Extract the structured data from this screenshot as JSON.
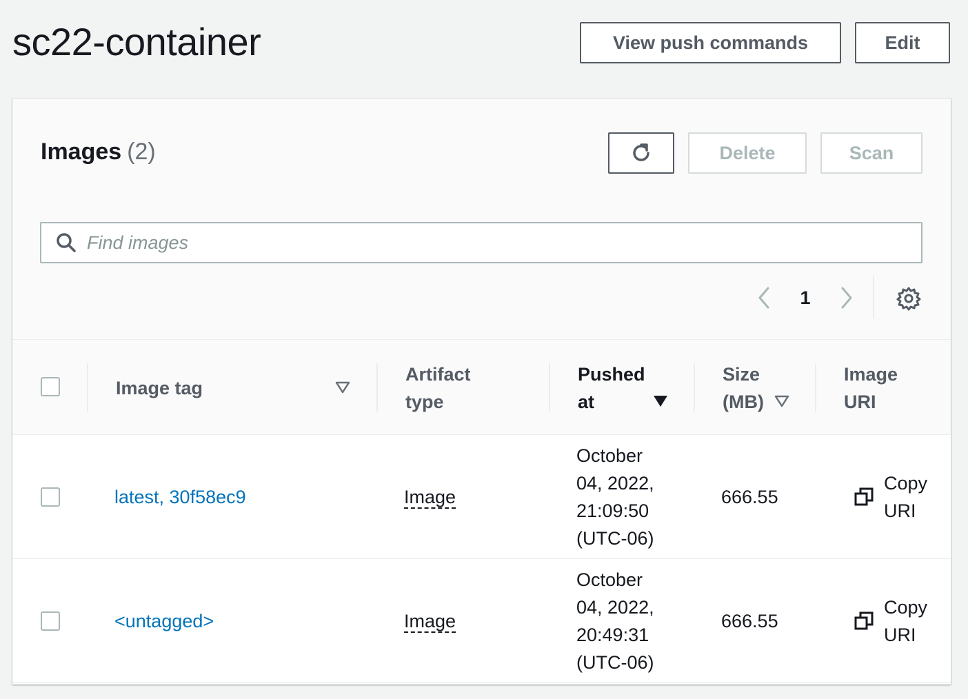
{
  "page": {
    "title": "sc22-container"
  },
  "header_actions": {
    "push_label": "View push commands",
    "edit_label": "Edit"
  },
  "panel": {
    "title": "Images",
    "count": "(2)",
    "delete_label": "Delete",
    "scan_label": "Scan",
    "refresh_icon": "refresh-icon"
  },
  "search": {
    "placeholder": "Find images",
    "value": ""
  },
  "pagination": {
    "current_page": "1"
  },
  "table": {
    "columns": {
      "image_tag": "Image tag",
      "artifact_type_1": "Artifact",
      "artifact_type_2": "type",
      "pushed_at_1": "Pushed",
      "pushed_at_2": "at",
      "size_1": "Size",
      "size_2": "(MB)",
      "uri_1": "Image",
      "uri_2": "URI"
    },
    "sorted_by": "Pushed at",
    "sort_direction": "descending",
    "rows": [
      {
        "tag": "latest, 30f58ec9",
        "artifact_type": "Image",
        "pushed_1": "October",
        "pushed_2": "04, 2022,",
        "pushed_3": "21:09:50",
        "pushed_4": "(UTC-06)",
        "size": "666.55",
        "copy_1": "Copy",
        "copy_2": "URI"
      },
      {
        "tag": "<untagged>",
        "artifact_type": "Image",
        "pushed_1": "October",
        "pushed_2": "04, 2022,",
        "pushed_3": "20:49:31",
        "pushed_4": "(UTC-06)",
        "size": "666.55",
        "copy_1": "Copy",
        "copy_2": "URI"
      }
    ]
  },
  "colors": {
    "link": "#0073bb",
    "text": "#16191f",
    "muted": "#545b64",
    "disabled": "#aab7b8"
  }
}
